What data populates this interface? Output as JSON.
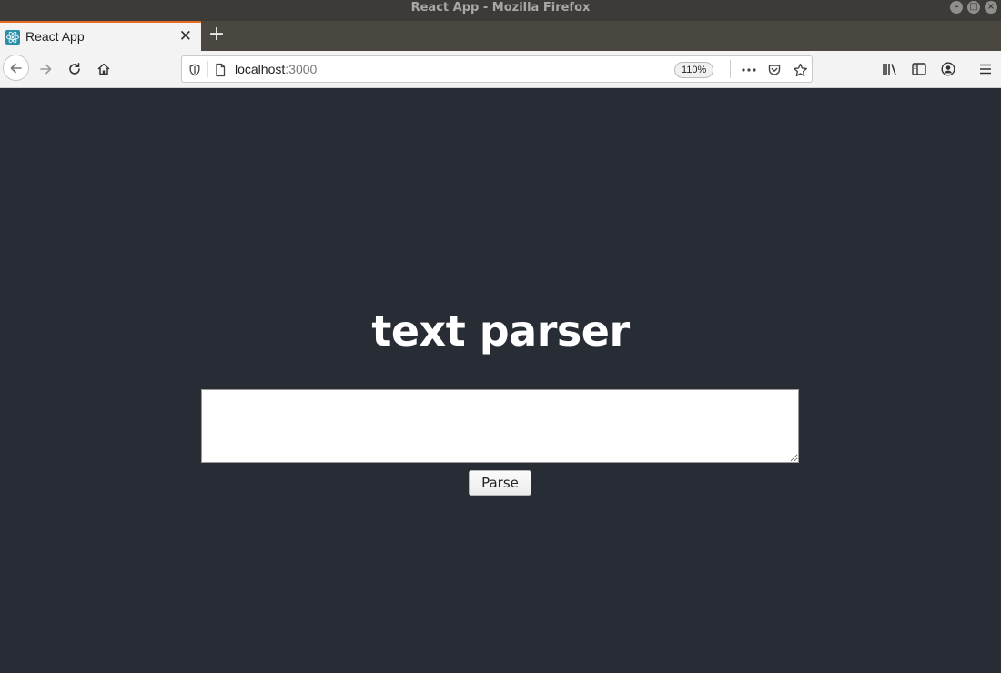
{
  "window": {
    "title": "React App - Mozilla Firefox"
  },
  "tabs": [
    {
      "title": "React App",
      "favicon": "react-logo-icon"
    }
  ],
  "urlbar": {
    "host": "localhost",
    "port": ":3000",
    "zoom": "110%"
  },
  "page": {
    "heading": "text parser",
    "textarea_value": "",
    "button_label": "Parse"
  },
  "colors": {
    "page_bg": "#282c34",
    "tab_accent": "#e66b24",
    "react_blue": "#2c8fa8"
  }
}
